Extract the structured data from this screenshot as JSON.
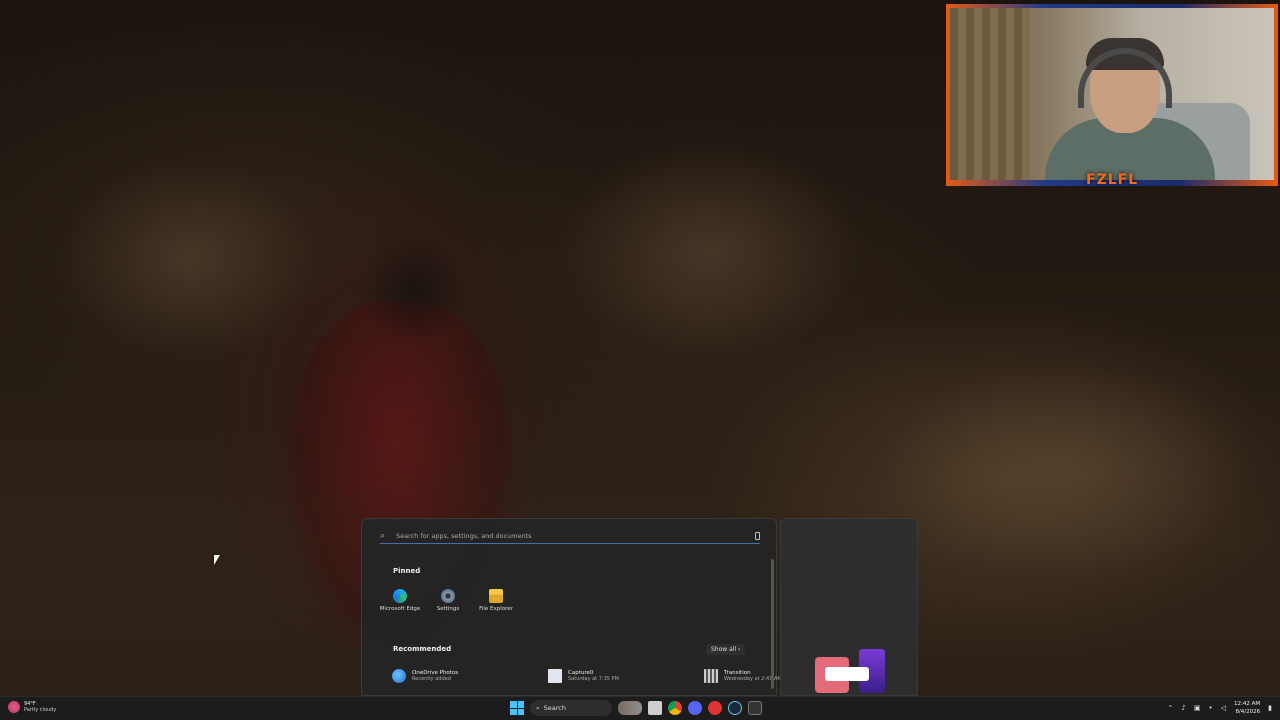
{
  "start_menu": {
    "search_placeholder": "Search for apps, settings, and documents",
    "pinned_title": "Pinned",
    "pinned_apps": [
      {
        "label": "Microsoft Edge",
        "icon": "edge-icon"
      },
      {
        "label": "Settings",
        "icon": "settings-gear-icon"
      },
      {
        "label": "File Explorer",
        "icon": "folder-icon"
      }
    ],
    "recommended_title": "Recommended",
    "show_all_label": "Show all",
    "recommended": [
      {
        "name": "OneDrive Photos",
        "sub": "Recently added",
        "icon": "onedrive-icon"
      },
      {
        "name": "Capture0",
        "sub": "Saturday at 7:35 PM",
        "icon": "document-icon"
      },
      {
        "name": "Transition",
        "sub": "Wednesday at 2:41 AM",
        "icon": "video-file-icon"
      }
    ]
  },
  "webcam": {
    "logo_text": "FZLFL"
  },
  "taskbar": {
    "weather_temp": "94°F",
    "weather_condition": "Partly cloudy",
    "search_label": "Search",
    "time": "12:42 AM",
    "date": "8/4/2026"
  },
  "colors": {
    "accent": "#4cc2ff",
    "menu_bg": "#242424",
    "taskbar_bg": "#1c1c1c",
    "webcam_border": "#e65a12"
  }
}
